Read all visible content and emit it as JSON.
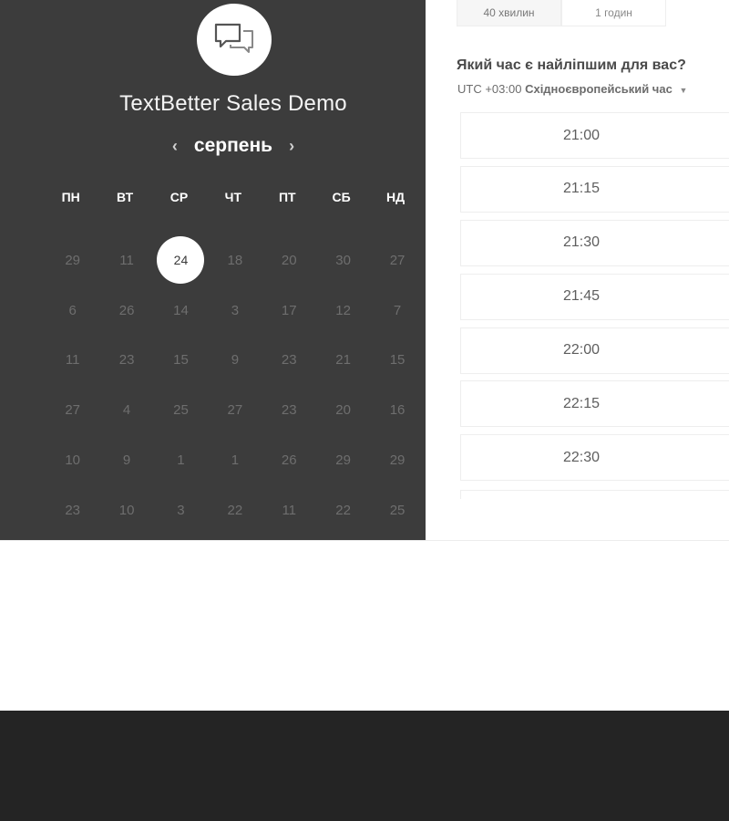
{
  "company": {
    "name": "TextBetter Sales Demo",
    "avatar_icon": "chat-bubbles-icon"
  },
  "calendar": {
    "month": "серпень",
    "prev_icon": "chevron-left-icon",
    "next_icon": "chevron-right-icon",
    "weekdays": [
      "ПН",
      "ВТ",
      "СР",
      "ЧТ",
      "ПТ",
      "СБ",
      "НД"
    ],
    "weeks": [
      [
        "29",
        "11",
        "24",
        "18",
        "20",
        "30",
        "27"
      ],
      [
        "6",
        "26",
        "14",
        "3",
        "17",
        "12",
        "7"
      ],
      [
        "11",
        "23",
        "15",
        "9",
        "23",
        "21",
        "15"
      ],
      [
        "27",
        "4",
        "25",
        "27",
        "23",
        "20",
        "16"
      ],
      [
        "10",
        "9",
        "1",
        "1",
        "26",
        "29",
        "29"
      ],
      [
        "23",
        "10",
        "3",
        "22",
        "11",
        "22",
        "25"
      ]
    ],
    "selected_day": "24"
  },
  "durations": [
    "40 хвилин",
    "1 годин"
  ],
  "question": "Який час є найліпшим для вас?",
  "timezone": {
    "offset": "UTC +03:00",
    "name": "Східноєвропейський час"
  },
  "time_slots": [
    "21:00",
    "21:15",
    "21:30",
    "21:45",
    "22:00",
    "22:15",
    "22:30"
  ],
  "colors": {
    "panel": "#3c3c3c",
    "footer": "#242424",
    "selected": "#ffffff"
  }
}
